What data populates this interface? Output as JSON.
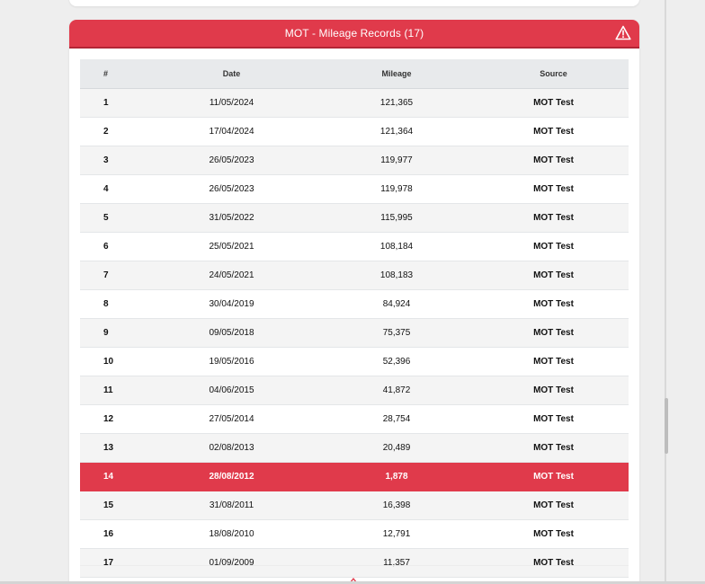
{
  "panel": {
    "title": "MOT - Mileage Records (17)",
    "header_color": "#e03a4b",
    "alert_icon": "warning-triangle-icon"
  },
  "table": {
    "columns": [
      "#",
      "Date",
      "Mileage",
      "Source"
    ],
    "rows": [
      {
        "num": "1",
        "date": "11/05/2024",
        "mileage": "121,365",
        "source": "MOT Test",
        "flagged": false
      },
      {
        "num": "2",
        "date": "17/04/2024",
        "mileage": "121,364",
        "source": "MOT Test",
        "flagged": false
      },
      {
        "num": "3",
        "date": "26/05/2023",
        "mileage": "119,977",
        "source": "MOT Test",
        "flagged": false
      },
      {
        "num": "4",
        "date": "26/05/2023",
        "mileage": "119,978",
        "source": "MOT Test",
        "flagged": false
      },
      {
        "num": "5",
        "date": "31/05/2022",
        "mileage": "115,995",
        "source": "MOT Test",
        "flagged": false
      },
      {
        "num": "6",
        "date": "25/05/2021",
        "mileage": "108,184",
        "source": "MOT Test",
        "flagged": false
      },
      {
        "num": "7",
        "date": "24/05/2021",
        "mileage": "108,183",
        "source": "MOT Test",
        "flagged": false
      },
      {
        "num": "8",
        "date": "30/04/2019",
        "mileage": "84,924",
        "source": "MOT Test",
        "flagged": false
      },
      {
        "num": "9",
        "date": "09/05/2018",
        "mileage": "75,375",
        "source": "MOT Test",
        "flagged": false
      },
      {
        "num": "10",
        "date": "19/05/2016",
        "mileage": "52,396",
        "source": "MOT Test",
        "flagged": false
      },
      {
        "num": "11",
        "date": "04/06/2015",
        "mileage": "41,872",
        "source": "MOT Test",
        "flagged": false
      },
      {
        "num": "12",
        "date": "27/05/2014",
        "mileage": "28,754",
        "source": "MOT Test",
        "flagged": false
      },
      {
        "num": "13",
        "date": "02/08/2013",
        "mileage": "20,489",
        "source": "MOT Test",
        "flagged": false
      },
      {
        "num": "14",
        "date": "28/08/2012",
        "mileage": "1,878",
        "source": "MOT Test",
        "flagged": true
      },
      {
        "num": "15",
        "date": "31/08/2011",
        "mileage": "16,398",
        "source": "MOT Test",
        "flagged": false
      },
      {
        "num": "16",
        "date": "18/08/2010",
        "mileage": "12,791",
        "source": "MOT Test",
        "flagged": false
      },
      {
        "num": "17",
        "date": "01/09/2009",
        "mileage": "11,357",
        "source": "MOT Test",
        "flagged": false
      }
    ]
  },
  "footer": {
    "expand_icon": "chevron-up-icon"
  }
}
